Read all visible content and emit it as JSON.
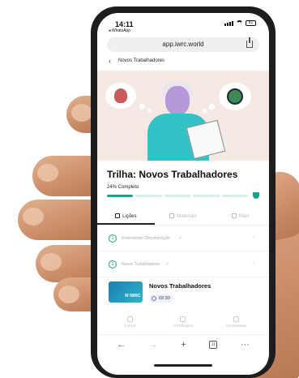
{
  "status_bar": {
    "time": "14:11",
    "back_app": "◂ WhatsApp",
    "battery": "81"
  },
  "browser": {
    "url": "app.iwrc.world"
  },
  "nav": {
    "back_glyph": "‹",
    "title": "Novos Trabalhadores"
  },
  "trail": {
    "title": "Trilha: Novos Trabalhadores",
    "progress_text": "24% Completo",
    "progress": 0.24,
    "segments_total": 5,
    "segments_done": 1
  },
  "tabs": [
    {
      "label": "Lições",
      "active": true
    },
    {
      "label": "Materiais",
      "active": false
    },
    {
      "label": "Mais",
      "active": false
    }
  ],
  "sections": [
    {
      "number": "1",
      "label": "Entendendo Discriminação",
      "check": "✓"
    },
    {
      "number": "2",
      "label": "Novos Trabalhadores",
      "check": "✓"
    }
  ],
  "course": {
    "thumb_text": "W",
    "thumb_brand": "IWRC",
    "title": "Novos Trabalhadores",
    "duration": "02:30"
  },
  "bottom_nav": [
    {
      "label": "Cursos",
      "icon": "courses-icon"
    },
    {
      "label": "Certificados",
      "icon": "certificate-icon"
    },
    {
      "label": "Comunidade",
      "icon": "community-icon"
    }
  ],
  "safari": {
    "back": "←",
    "forward": "→",
    "new_tab": "+",
    "tabs_count": "11",
    "more": "···"
  },
  "colors": {
    "accent": "#1aa386",
    "hero_bg": "#f6e9e4",
    "phone_body": "#1d1d1f"
  }
}
